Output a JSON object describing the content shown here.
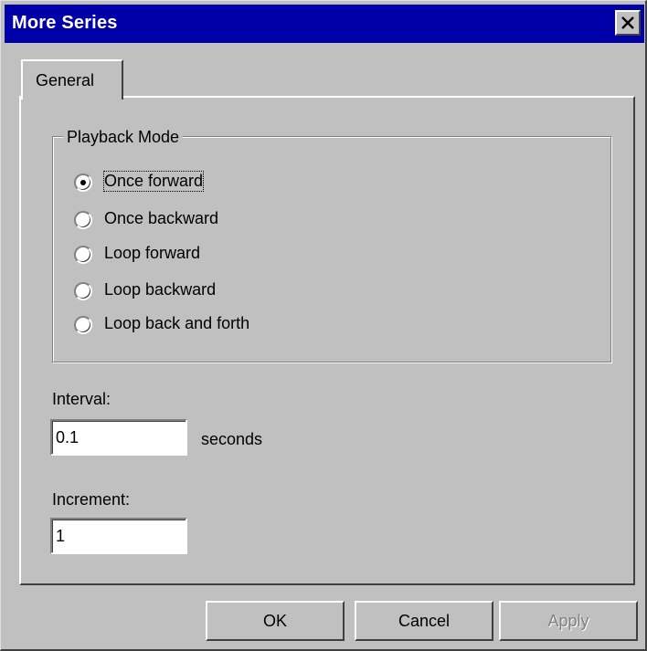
{
  "window": {
    "title": "More Series"
  },
  "tabs": [
    {
      "label": "General"
    }
  ],
  "playback": {
    "legend": "Playback Mode",
    "options": [
      {
        "label": "Once forward",
        "selected": true
      },
      {
        "label": "Once backward",
        "selected": false
      },
      {
        "label": "Loop forward",
        "selected": false
      },
      {
        "label": "Loop backward",
        "selected": false
      },
      {
        "label": "Loop back and forth",
        "selected": false
      }
    ]
  },
  "interval": {
    "label": "Interval:",
    "value": "0.1",
    "units": "seconds"
  },
  "increment": {
    "label": "Increment:",
    "value": "1"
  },
  "buttons": {
    "ok": "OK",
    "cancel": "Cancel",
    "apply": "Apply"
  },
  "colors": {
    "titlebar": "#0000a8",
    "face": "#c0c0c0"
  }
}
